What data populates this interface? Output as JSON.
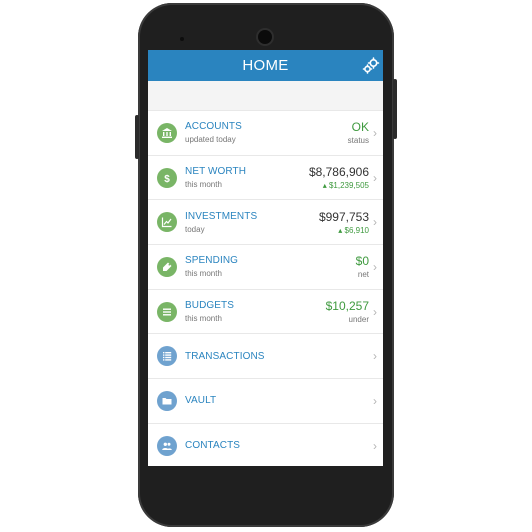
{
  "header": {
    "title": "HOME",
    "settings_icon": "gear-icon"
  },
  "colors": {
    "accent": "#2a84bf",
    "positive": "#3f9a3f",
    "icon_green": "#79b566",
    "icon_blue": "#6fa2cf"
  },
  "rows": [
    {
      "title": "ACCOUNTS",
      "subtitle": "updated today",
      "value": "OK",
      "value_sub": "status",
      "icon": "bank-icon"
    },
    {
      "title": "NET WORTH",
      "subtitle": "this month",
      "value": "$8,786,906",
      "value_sub": "▴ $1,239,505",
      "icon": "dollar-icon"
    },
    {
      "title": "INVESTMENTS",
      "subtitle": "today",
      "value": "$997,753",
      "value_sub": "▴ $6,910",
      "icon": "chart-icon"
    },
    {
      "title": "SPENDING",
      "subtitle": "this month",
      "value": "$0",
      "value_sub": "net",
      "icon": "tag-icon"
    },
    {
      "title": "BUDGETS",
      "subtitle": "this month",
      "value": "$10,257",
      "value_sub": "under",
      "icon": "list-icon"
    },
    {
      "title": "TRANSACTIONS",
      "icon": "transactions-icon"
    },
    {
      "title": "VAULT",
      "icon": "folder-icon"
    },
    {
      "title": "CONTACTS",
      "icon": "contacts-icon"
    }
  ]
}
